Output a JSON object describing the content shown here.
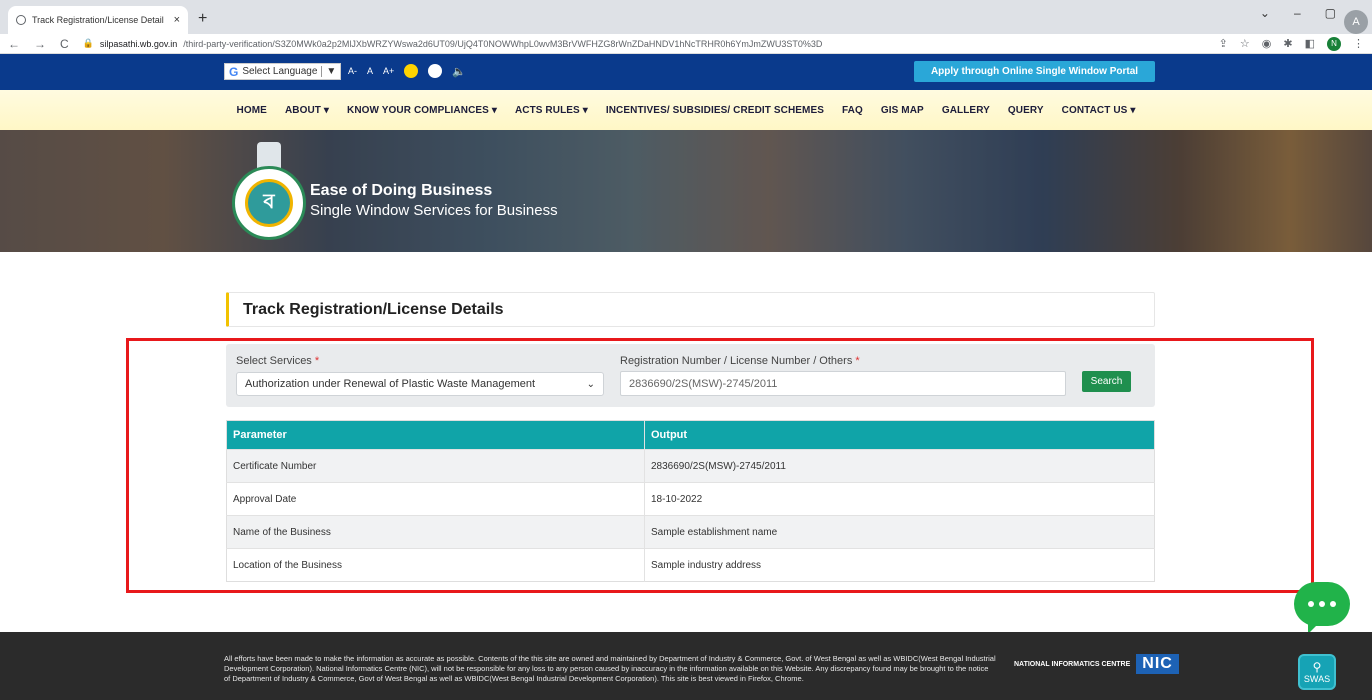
{
  "browser": {
    "tab_title": "Track Registration/License Detail",
    "tab_close": "×",
    "new_tab": "+",
    "url_host": "silpasathi.wb.gov.in",
    "url_path": "/third-party-verification/S3Z0MWk0a2p2MlJXbWRZYWswa2d6UT09/UjQ4T0NOWWhpL0wvM3BrVWFHZG8rWnZDaHNDV1hNcTRHR0h6YmJmZWU3ST0%3D",
    "profile_initial": "N",
    "back_glyph": "←",
    "forward_glyph": "→",
    "reload_glyph": "C"
  },
  "topbar": {
    "language_label": "Select Language",
    "language_arrow": "▼",
    "font_smaller": "A-",
    "font_normal": "A",
    "font_larger": "A+",
    "apply_button": "Apply through Online Single Window Portal"
  },
  "menu": {
    "items": [
      {
        "label": "HOME"
      },
      {
        "label": "ABOUT ▾"
      },
      {
        "label": "KNOW YOUR COMPLIANCES ▾"
      },
      {
        "label": "ACTS RULES ▾"
      },
      {
        "label": "INCENTIVES/ SUBSIDIES/ CREDIT SCHEMES"
      },
      {
        "label": "FAQ"
      },
      {
        "label": "GIS MAP"
      },
      {
        "label": "GALLERY"
      },
      {
        "label": "QUERY"
      },
      {
        "label": "CONTACT US ▾"
      }
    ]
  },
  "hero": {
    "title": "Ease of Doing Business",
    "subtitle": "Single Window Services for Business",
    "logo_letter": "ব"
  },
  "page": {
    "title": "Track Registration/License Details"
  },
  "search": {
    "services_label": "Select Services",
    "required_mark": "*",
    "services_selected": "Authorization under Renewal of Plastic Waste Management",
    "number_label": "Registration Number / License Number / Others",
    "number_value": "2836690/2S(MSW)-2745/2011",
    "search_button": "Search"
  },
  "table": {
    "headers": {
      "parameter": "Parameter",
      "output": "Output"
    },
    "rows": [
      {
        "parameter": "Certificate Number",
        "output": "2836690/2S(MSW)-2745/2011"
      },
      {
        "parameter": "Approval Date",
        "output": "18-10-2022"
      },
      {
        "parameter": "Name of the Business",
        "output": "Sample establishment name"
      },
      {
        "parameter": "Location of the Business",
        "output": "Sample industry address"
      }
    ]
  },
  "footer": {
    "disclaimer": "All efforts have been made to make the information as accurate as possible. Contents of the this site are owned and maintained by Department of Industry & Commerce, Govt. of West Bengal as well as WBIDC(West Bengal Industrial Development Corporation). National Informatics Centre (NIC), will not be responsible for any loss to any person caused by inaccuracy in the information available on this Website. Any discrepancy found may be brought to the notice of Department of Industry & Commerce, Govt of West Bengal as well as WBIDC(West Bengal Industrial Development Corporation). This site is best viewed in Firefox, Chrome.",
    "nic_small": "NATIONAL INFORMATICS CENTRE",
    "nic_big": "NIC",
    "swas_label": "SWAS"
  },
  "colors": {
    "topbar": "#0a3a8c",
    "accent_teal": "#10a4a8",
    "search_green": "#1f8f4e",
    "highlight_red": "#e8181b",
    "title_bar_yellow": "#f2c200",
    "chat_green": "#21b34a"
  }
}
